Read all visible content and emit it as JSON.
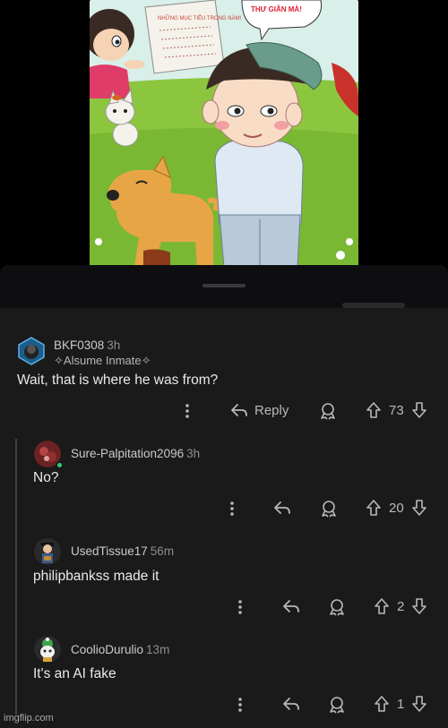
{
  "comments": [
    {
      "username": "BKF0308",
      "time": "3h",
      "flair": "Alsume Inmate",
      "body": "Wait, that is where he was from?",
      "reply_label": "Reply",
      "score": "73"
    },
    {
      "username": "Sure-Palpitation2096",
      "time": "3h",
      "body": "No?",
      "score": "20"
    },
    {
      "username": "UsedTissue17",
      "time": "56m",
      "body": "philipbankss made it",
      "score": "2"
    },
    {
      "username": "CoolioDurulio",
      "time": "13m",
      "body": "It's an AI fake",
      "score": "1"
    }
  ],
  "photo": {
    "caption_left": "NHỮNG MỤC TIÊU TRONG NĂM!",
    "bubble_text": "THƯ GIÃN MÀ!"
  },
  "watermark": "imgflip.com",
  "colors": {
    "background": "#1a1a1b",
    "text": "#d7dadc",
    "muted": "#8b8e90"
  }
}
